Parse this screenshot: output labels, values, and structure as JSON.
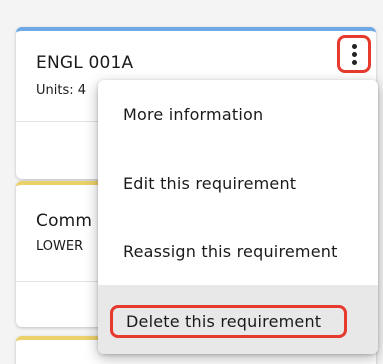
{
  "cards": [
    {
      "title": "ENGL 001A",
      "subtitle": "Units: 4",
      "accent": "#6ea8e6"
    },
    {
      "title": "Comm",
      "subtitle": "LOWER",
      "accent": "#ecd06a"
    },
    {
      "accent": "#ecd06a"
    }
  ],
  "menu": {
    "items": [
      {
        "label": "More information"
      },
      {
        "label": "Edit this requirement"
      },
      {
        "label": "Reassign this requirement"
      },
      {
        "label": "Delete this requirement"
      }
    ]
  },
  "colors": {
    "highlight": "#e63a2e",
    "hover_background": "#e8e8e8"
  },
  "icons": {
    "options_button": "kebab-vertical-icon"
  }
}
